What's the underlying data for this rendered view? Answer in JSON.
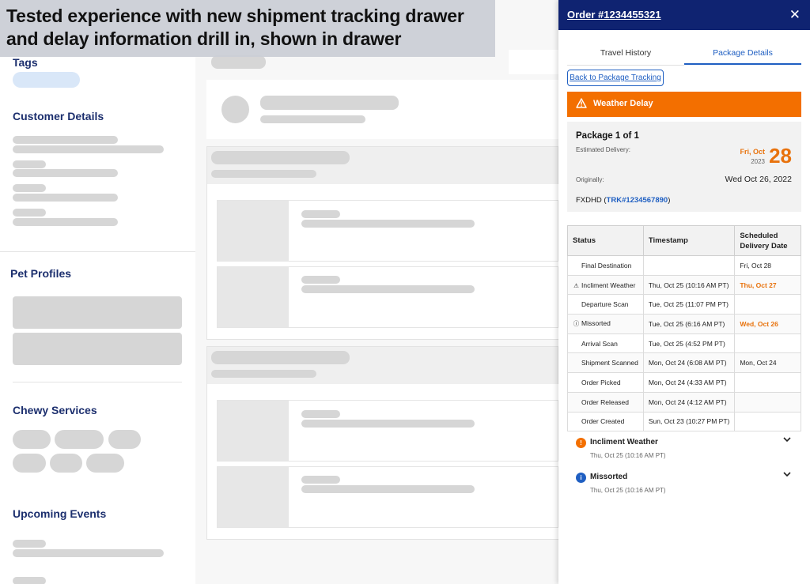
{
  "banner": {
    "line1": "Tested experience with new shipment tracking drawer",
    "line2": "and delay information drill in, shown in drawer"
  },
  "sidebar": {
    "tags_title": "Tags",
    "customer_details_title": "Customer Details",
    "pet_profiles_title": "Pet Profiles",
    "chewy_services_title": "Chewy Services",
    "upcoming_events_title": "Upcoming Events"
  },
  "drawer": {
    "title": "Order #1234455321",
    "close_icon": "close-icon",
    "tabs": [
      {
        "label": "Travel History",
        "active": false
      },
      {
        "label": "Package Details",
        "active": true
      }
    ],
    "back_link": "Back to Package Tracking",
    "alert": {
      "label": "Weather Delay",
      "icon": "warning-triangle-icon",
      "color": "#f36f00"
    },
    "package": {
      "title": "Package 1 of 1",
      "estimated_label": "Estimated Delivery:",
      "est_dow": "Fri, Oct",
      "est_year": "2023",
      "est_day": "28",
      "originally_label": "Originally:",
      "originally_value": "Wed Oct 26, 2022",
      "carrier": "FXDHD",
      "tracking": "TRK#1234567890"
    },
    "table": {
      "headers": [
        "Status",
        "Timestamp",
        "Scheduled Delivery Date"
      ],
      "rows": [
        {
          "status": "Final Destination",
          "icon": "",
          "timestamp": "",
          "scheduled": "Fri, Oct 28",
          "highlight": false
        },
        {
          "status": "Incliment Weather",
          "icon": "warning-triangle-icon",
          "timestamp": "Thu, Oct 25 (10:16 AM PT)",
          "scheduled": "Thu, Oct 27",
          "highlight": true
        },
        {
          "status": "Departure Scan",
          "icon": "",
          "timestamp": "Tue, Oct 25 (11:07 PM PT)",
          "scheduled": "",
          "highlight": false
        },
        {
          "status": "Missorted",
          "icon": "info-circle-icon",
          "timestamp": "Tue, Oct 25 (6:16 AM PT)",
          "scheduled": "Wed, Oct 26",
          "highlight": true
        },
        {
          "status": "Arrival Scan",
          "icon": "",
          "timestamp": "Tue, Oct 25 (4:52 PM PT)",
          "scheduled": "",
          "highlight": false
        },
        {
          "status": "Shipment Scanned",
          "icon": "",
          "timestamp": "Mon, Oct 24 (6:08 AM PT)",
          "scheduled": "Mon, Oct 24",
          "highlight": false
        },
        {
          "status": "Order Picked",
          "icon": "",
          "timestamp": "Mon, Oct 24 (4:33 AM PT)",
          "scheduled": "",
          "highlight": false
        },
        {
          "status": "Order Released",
          "icon": "",
          "timestamp": "Mon, Oct 24 (4:12 AM PT)",
          "scheduled": "",
          "highlight": false
        },
        {
          "status": "Order Created",
          "icon": "",
          "timestamp": "Sun, Oct 23 (10:27 PM PT)",
          "scheduled": "",
          "highlight": false
        }
      ]
    },
    "accordions": [
      {
        "title": "Incliment Weather",
        "time": "Thu, Oct 25 (10:16 AM PT)",
        "icon": "warning-triangle-icon",
        "color": "#f36f00",
        "glyph": "!"
      },
      {
        "title": "Missorted",
        "time": "Thu, Oct 25 (10:16 AM PT)",
        "icon": "info-circle-icon",
        "color": "#1f5fc2",
        "glyph": "i"
      }
    ]
  },
  "colors": {
    "navy": "#0f2371",
    "accent_blue": "#1f5fc2",
    "orange": "#f36f00"
  }
}
